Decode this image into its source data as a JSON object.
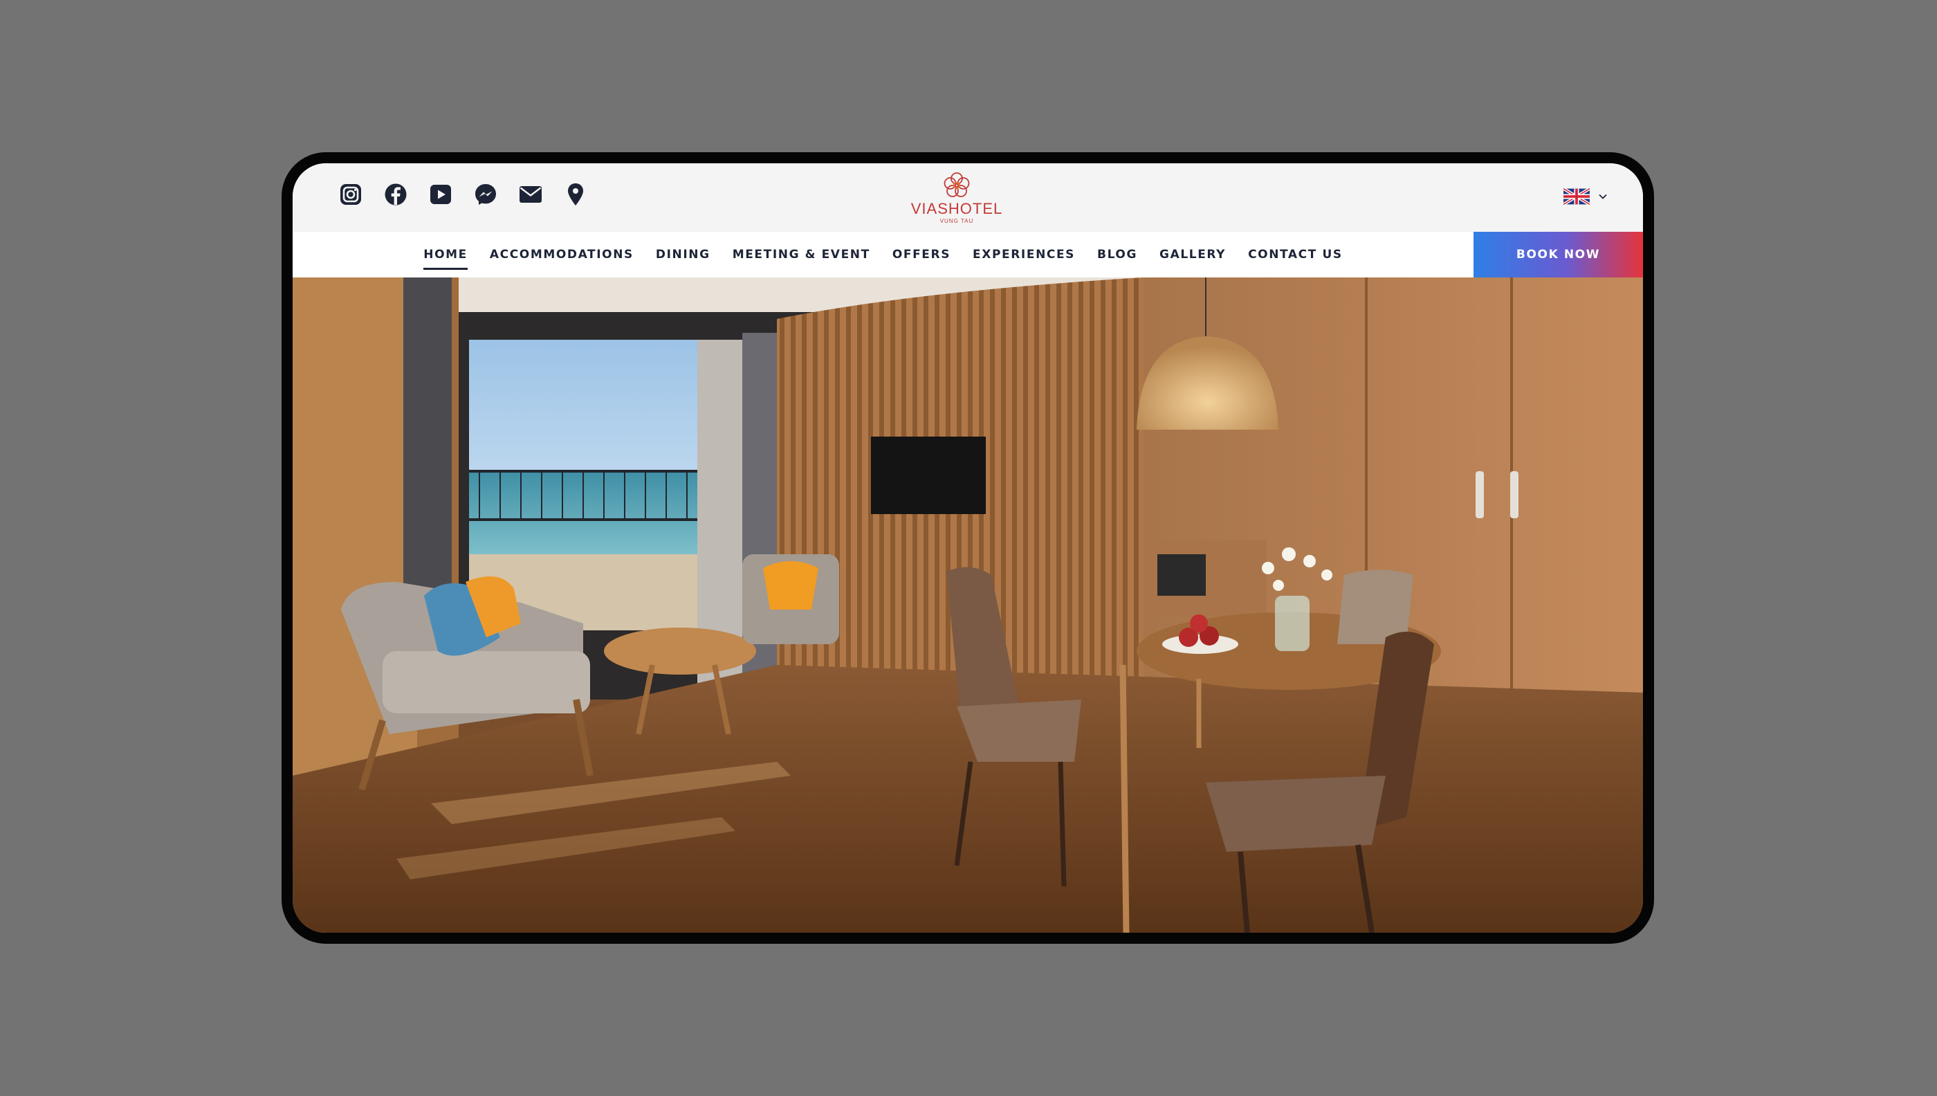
{
  "social": {
    "icons": [
      "instagram-icon",
      "facebook-icon",
      "youtube-icon",
      "messenger-icon",
      "email-icon",
      "location-pin-icon"
    ]
  },
  "logo": {
    "brand_part1": "VIAS",
    "brand_part2": "HOTEL",
    "subtitle": "VUNG TAU",
    "color": "#c23b38"
  },
  "language": {
    "selected": "English",
    "flag": "uk-flag-icon"
  },
  "nav": {
    "items": [
      {
        "label": "HOME",
        "active": true
      },
      {
        "label": "ACCOMMODATIONS"
      },
      {
        "label": "DINING"
      },
      {
        "label": "MEETING & EVENT"
      },
      {
        "label": "OFFERS"
      },
      {
        "label": "EXPERIENCES"
      },
      {
        "label": "BLOG"
      },
      {
        "label": "GALLERY"
      },
      {
        "label": "CONTACT US"
      }
    ],
    "book_label": "BOOK NOW",
    "book_gradient": [
      "#2f7fe6",
      "#e5343b"
    ]
  },
  "colors": {
    "nav_text": "#1d2436",
    "topbar_bg": "#f4f4f4",
    "page_bg": "#737373",
    "device_frame": "#050505"
  }
}
